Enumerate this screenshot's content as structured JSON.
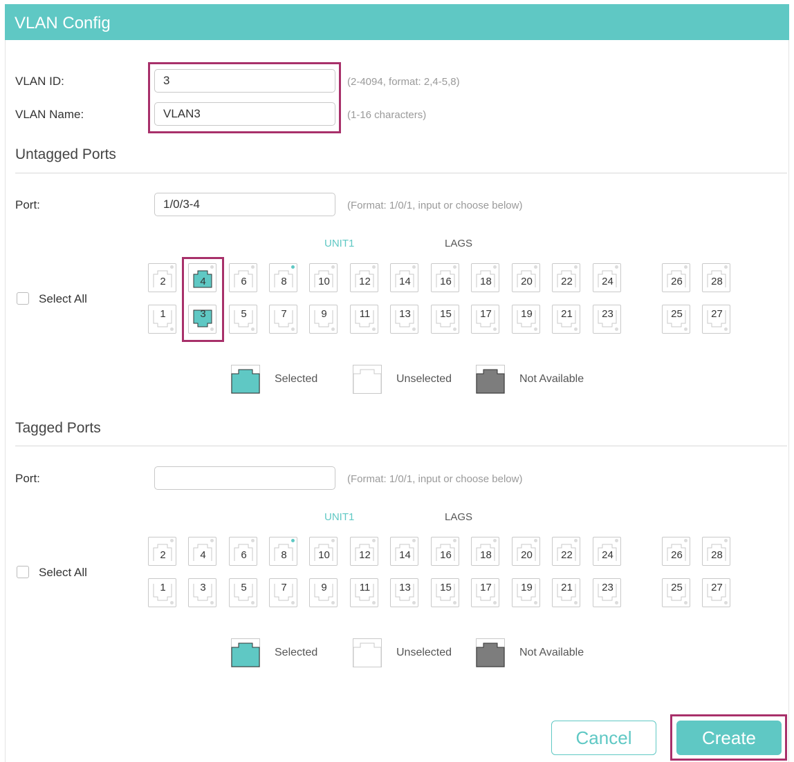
{
  "dialog": {
    "title": "VLAN Config"
  },
  "vlan_id": {
    "label": "VLAN ID:",
    "value": "3",
    "hint": "(2-4094, format: 2,4-5,8)"
  },
  "vlan_name": {
    "label": "VLAN Name:",
    "value": "VLAN3",
    "hint": "(1-16 characters)"
  },
  "untagged": {
    "title": "Untagged Ports",
    "port_label": "Port:",
    "port_value": "1/0/3-4",
    "port_hint": "(Format: 1/0/1, input or choose below)",
    "select_all": "Select All",
    "unit_label": "UNIT1",
    "lags_label": "LAGS",
    "selected_ports": [
      "3",
      "4"
    ]
  },
  "tagged": {
    "title": "Tagged Ports",
    "port_label": "Port:",
    "port_value": "",
    "port_hint": "(Format: 1/0/1, input or choose below)",
    "select_all": "Select All",
    "unit_label": "UNIT1",
    "lags_label": "LAGS",
    "selected_ports": []
  },
  "ports": {
    "top_row": [
      "2",
      "4",
      "6",
      "8",
      "10",
      "12",
      "14",
      "16",
      "18",
      "20",
      "22",
      "24",
      "26",
      "28"
    ],
    "bottom_row": [
      "1",
      "3",
      "5",
      "7",
      "9",
      "11",
      "13",
      "15",
      "17",
      "19",
      "21",
      "23",
      "25",
      "27"
    ],
    "link_up": [
      "8"
    ]
  },
  "legend": {
    "selected": "Selected",
    "unselected": "Unselected",
    "not_available": "Not Available"
  },
  "colors": {
    "accent": "#5fc8c4",
    "highlight": "#a8306a",
    "not_available": "#7d7d7d"
  },
  "buttons": {
    "cancel": "Cancel",
    "create": "Create"
  }
}
